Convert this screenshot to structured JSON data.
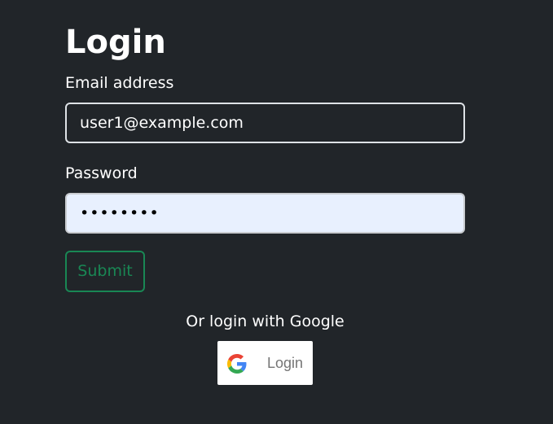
{
  "page": {
    "title": "Login"
  },
  "form": {
    "email_label": "Email address",
    "email_value": "user1@example.com",
    "password_label": "Password",
    "password_masked": "••••••••",
    "submit_label": "Submit"
  },
  "google": {
    "prompt": "Or login with Google",
    "button_label": "Login",
    "icon": "google-icon"
  },
  "colors": {
    "background": "#212529",
    "text": "#ffffff",
    "submit_accent": "#198754",
    "password_autofill_bg": "#e8f0fe"
  }
}
